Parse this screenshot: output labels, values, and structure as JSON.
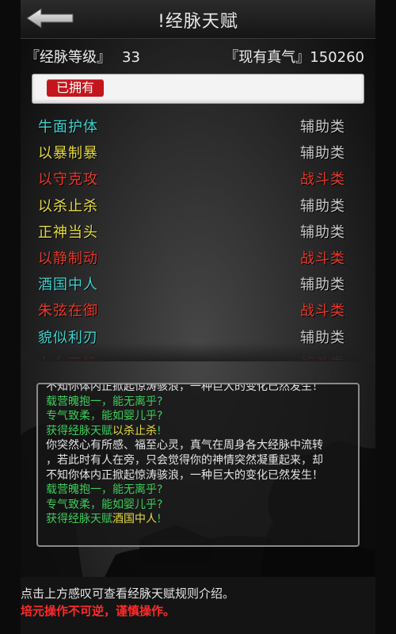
{
  "colors": {
    "talent_cyan": "#3ed3d0",
    "talent_yellow": "#e6dc42",
    "talent_red": "#e8392e",
    "type_support": "#c9c9c9",
    "type_combat": "#e8392e",
    "log_green": "#3dcc5a",
    "log_white": "#e4e4e4",
    "log_yellow": "#e6dc42",
    "tab_red": "#c4151c",
    "warning_red": "#ff2a2a"
  },
  "header": {
    "title": "!经脉天赋"
  },
  "stats": {
    "level_label": "『经脉等级』",
    "level_value": "33",
    "qi_label": "『现有真气』",
    "qi_value": "150260"
  },
  "tabs": {
    "owned_label": "已拥有"
  },
  "talents": [
    {
      "name": "牛面护体",
      "type": "辅助类",
      "name_color": "cyan",
      "type_kind": "support"
    },
    {
      "name": "以暴制暴",
      "type": "辅助类",
      "name_color": "yellow",
      "type_kind": "support"
    },
    {
      "name": "以守克攻",
      "type": "战斗类",
      "name_color": "red",
      "type_kind": "combat"
    },
    {
      "name": "以杀止杀",
      "type": "辅助类",
      "name_color": "yellow",
      "type_kind": "support"
    },
    {
      "name": "正神当头",
      "type": "辅助类",
      "name_color": "yellow",
      "type_kind": "support"
    },
    {
      "name": "以静制动",
      "type": "战斗类",
      "name_color": "red",
      "type_kind": "combat"
    },
    {
      "name": "酒国中人",
      "type": "辅助类",
      "name_color": "cyan",
      "type_kind": "support"
    },
    {
      "name": "朱弦在御",
      "type": "战斗类",
      "name_color": "red",
      "type_kind": "combat"
    },
    {
      "name": "貌似利刃",
      "type": "辅助类",
      "name_color": "cyan",
      "type_kind": "support"
    },
    {
      "name": "女女天犊",
      "type": "战斗类",
      "name_color": "red",
      "type_kind": "combat"
    }
  ],
  "log": [
    {
      "parts": [
        {
          "text": "不知你体内正掀起惊涛骇浪，一种巨大的变化已然发生！",
          "color": "white"
        }
      ]
    },
    {
      "parts": [
        {
          "text": "载营魄抱一，能无离乎?",
          "color": "green"
        }
      ]
    },
    {
      "parts": [
        {
          "text": "专气致柔，能如婴儿乎?",
          "color": "green"
        }
      ]
    },
    {
      "parts": [
        {
          "text": "获得经脉天赋",
          "color": "green"
        },
        {
          "text": "以杀止杀",
          "color": "yellow"
        },
        {
          "text": "!",
          "color": "green"
        }
      ]
    },
    {
      "parts": [
        {
          "text": "你突然心有所感、福至心灵，真气在周身各大经脉中流转",
          "color": "white"
        }
      ]
    },
    {
      "parts": [
        {
          "text": "，若此时有人在旁，只会觉得你的神情突然凝重起来，却",
          "color": "white"
        }
      ]
    },
    {
      "parts": [
        {
          "text": "不知你体内正掀起惊涛骇浪，一种巨大的变化已然发生！",
          "color": "white"
        }
      ]
    },
    {
      "parts": [
        {
          "text": "载营魄抱一，能无离乎?",
          "color": "green"
        }
      ]
    },
    {
      "parts": [
        {
          "text": "专气致柔，能如婴儿乎?",
          "color": "green"
        }
      ]
    },
    {
      "parts": [
        {
          "text": "获得经脉天赋",
          "color": "green"
        },
        {
          "text": "酒国中人",
          "color": "yellow"
        },
        {
          "text": "!",
          "color": "green"
        }
      ]
    }
  ],
  "footer": {
    "hint": "点击上方感叹可查看经脉天赋规则介绍。",
    "warning": "培元操作不可逆，谨慎操作。"
  }
}
